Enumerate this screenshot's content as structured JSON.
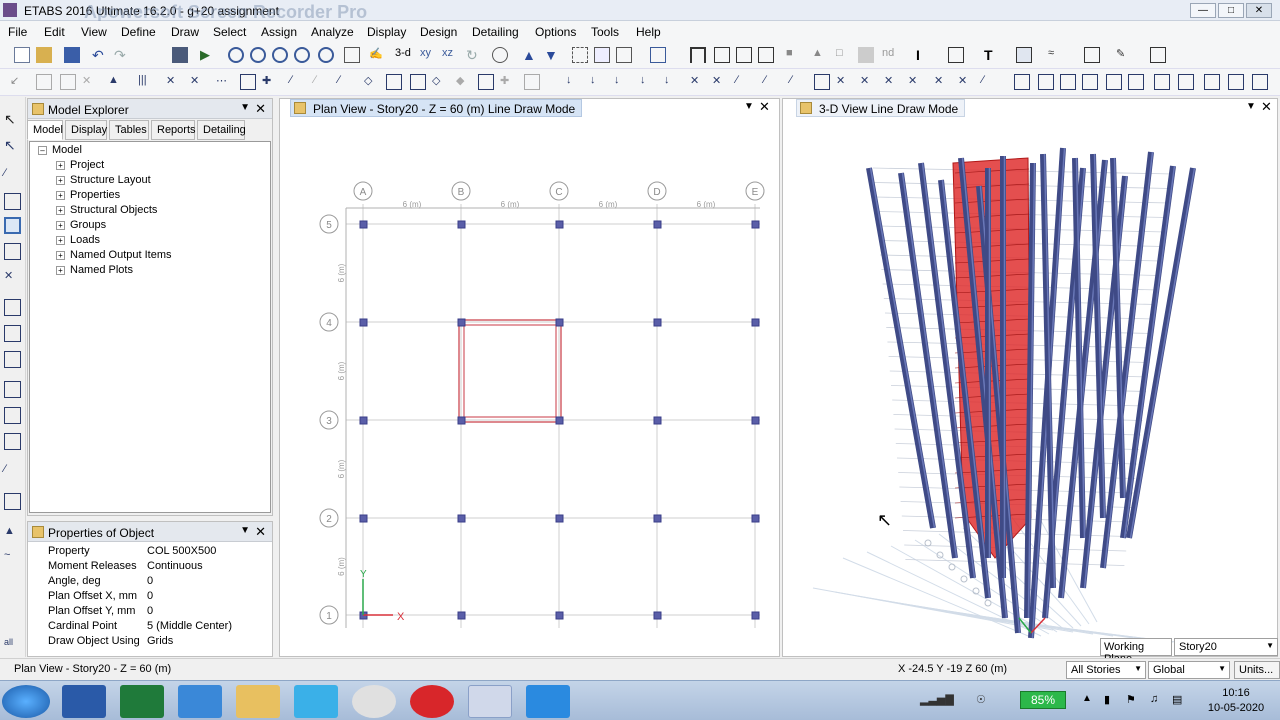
{
  "app": {
    "title": "ETABS 2016 Ultimate 16.2.0 - g+20 assignment",
    "watermark": "Apowersoft Screen Recorder Pro"
  },
  "menu": [
    "File",
    "Edit",
    "View",
    "Define",
    "Draw",
    "Select",
    "Assign",
    "Analyze",
    "Display",
    "Design",
    "Detailing",
    "Options",
    "Tools",
    "Help"
  ],
  "toolbar": {
    "view_3d_label": "3-d",
    "nd_label": "nd"
  },
  "model_explorer": {
    "title": "Model Explorer",
    "tabs": [
      "Model",
      "Display",
      "Tables",
      "Reports",
      "Detailing"
    ],
    "root": "Model",
    "items": [
      "Project",
      "Structure Layout",
      "Properties",
      "Structural Objects",
      "Groups",
      "Loads",
      "Named Output Items",
      "Named Plots"
    ]
  },
  "properties": {
    "title": "Properties of Object",
    "rows": [
      {
        "label": "Property",
        "value": "COL 500X500"
      },
      {
        "label": "Moment Releases",
        "value": "Continuous"
      },
      {
        "label": "Angle, deg",
        "value": "0"
      },
      {
        "label": "Plan Offset X, mm",
        "value": "0"
      },
      {
        "label": "Plan Offset Y, mm",
        "value": "0"
      },
      {
        "label": "Cardinal Point",
        "value": "5 (Middle Center)"
      },
      {
        "label": "Draw Object Using",
        "value": "Grids"
      }
    ]
  },
  "plan_view": {
    "title": "Plan View - Story20 - Z = 60 (m)  Line Draw Mode",
    "grid_x": [
      "A",
      "B",
      "C",
      "D",
      "E"
    ],
    "grid_y": [
      "5",
      "4",
      "3",
      "2",
      "1"
    ],
    "spacing_label": "6 (m)",
    "axis_x": "X",
    "axis_y": "Y"
  },
  "view_3d": {
    "title": "3-D View  Line Draw Mode",
    "working_plane_label": "Working Plane",
    "working_plane_value": "Story20"
  },
  "status": {
    "left": "Plan View - Story20 - Z = 60 (m)",
    "coords": "X -24.5  Y -19  Z 60 (m)",
    "stories": "All Stories",
    "coord_system": "Global",
    "units": "Units..."
  },
  "taskbar": {
    "battery": "85%",
    "time": "10:16",
    "date": "10-05-2020"
  },
  "colors": {
    "column_blue": "#3f4a86",
    "selected_red": "#d9302a",
    "grid_gray": "#c8c8c8",
    "beam_red": "#c83a44"
  }
}
